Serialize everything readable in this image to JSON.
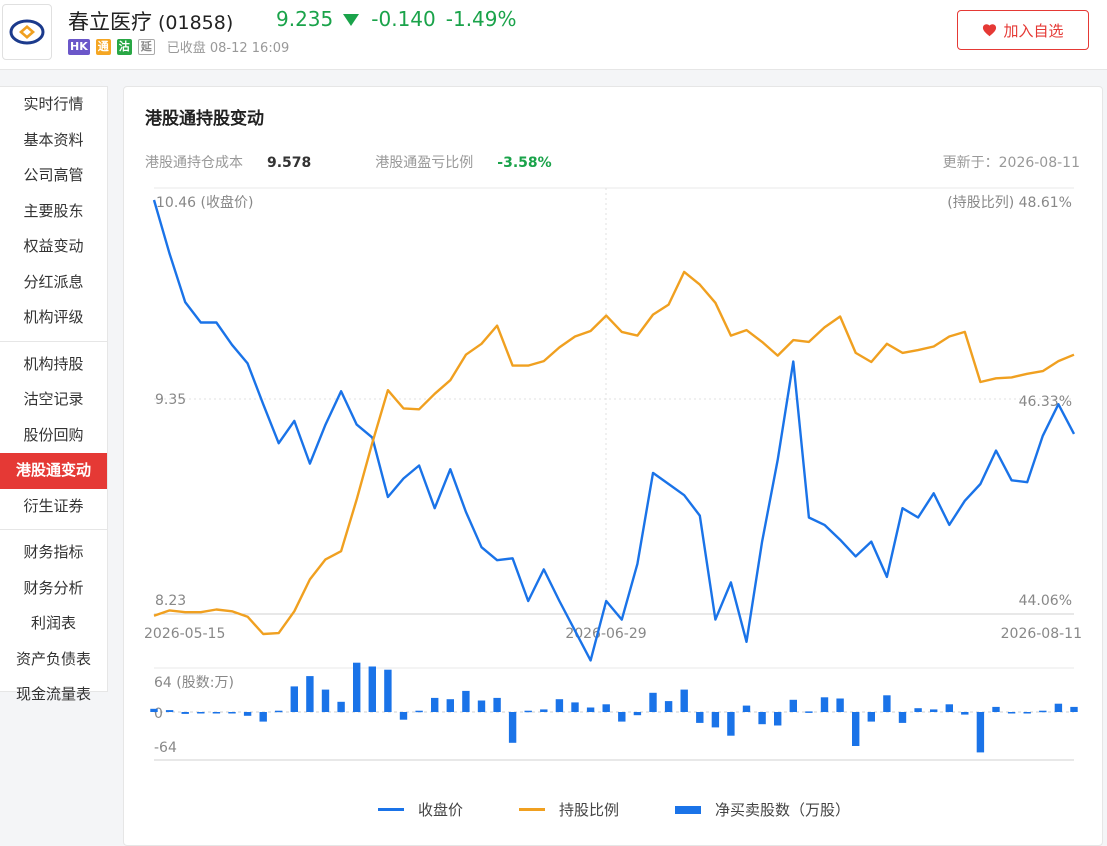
{
  "header": {
    "name": "春立医疗",
    "code": "(01858)",
    "price": "9.235",
    "change": "-0.140",
    "change_pct": "-1.49%",
    "tags": [
      "HK",
      "通",
      "沽",
      "延"
    ],
    "status": "已收盘 08-12 16:09",
    "watch_label": "加入自选"
  },
  "sidebar": {
    "groups": [
      [
        "实时行情",
        "基本资料",
        "公司高管",
        "主要股东",
        "权益变动",
        "分红派息",
        "机构评级"
      ],
      [
        "机构持股",
        "沽空记录",
        "股份回购",
        "港股通变动",
        "衍生证券"
      ],
      [
        "财务指标",
        "财务分析",
        "利润表",
        "资产负债表",
        "现金流量表"
      ]
    ],
    "active": "港股通变动"
  },
  "panel": {
    "title": "港股通持股变动",
    "cost_label": "港股通持仓成本",
    "cost_value": "9.578",
    "pl_label": "港股通盈亏比例",
    "pl_value": "-3.58%",
    "updated": "更新于：2026-08-11"
  },
  "chart_data": {
    "type": "line",
    "x_ticks": [
      "2026-05-15",
      "2026-06-29",
      "2026-08-11"
    ],
    "price_axis": {
      "label": "10.46 (收盘价)",
      "max": 10.46,
      "mid": 9.35,
      "min": 8.23,
      "mid_label": "9.35",
      "min_label": "8.23"
    },
    "ratio_axis": {
      "label": "(持股比列) 48.61%",
      "max": 48.61,
      "mid": 46.33,
      "min": 44.06,
      "mid_label": "46.33%",
      "min_label": "44.06%"
    },
    "volume_axis": {
      "label": "64 (股数:万)",
      "max": 64,
      "min": -64,
      "zero_label": "0",
      "min_label": "-64"
    },
    "series": [
      {
        "name": "收盘价",
        "color": "#1a73e8",
        "values": [
          10.46,
          10.17,
          9.91,
          9.8,
          9.8,
          9.68,
          9.58,
          9.36,
          9.15,
          9.27,
          9.04,
          9.25,
          9.43,
          9.25,
          9.18,
          8.86,
          8.96,
          9.03,
          8.8,
          9.01,
          8.78,
          8.59,
          8.52,
          8.53,
          8.3,
          8.47,
          8.3,
          8.14,
          7.98,
          8.3,
          8.2,
          8.5,
          8.99,
          8.93,
          8.87,
          8.76,
          8.2,
          8.4,
          8.08,
          8.62,
          9.06,
          9.59,
          8.75,
          8.71,
          8.63,
          8.54,
          8.62,
          8.43,
          8.8,
          8.75,
          8.88,
          8.71,
          8.84,
          8.93,
          9.11,
          8.95,
          8.94,
          9.19,
          9.36,
          9.2
        ]
      },
      {
        "name": "持股比例",
        "color": "#f0a020",
        "values": [
          44.04,
          44.1,
          44.08,
          44.08,
          44.11,
          44.09,
          44.03,
          43.84,
          43.85,
          44.09,
          44.44,
          44.66,
          44.75,
          45.32,
          45.94,
          46.52,
          46.32,
          46.31,
          46.48,
          46.63,
          46.91,
          47.03,
          47.23,
          46.79,
          46.79,
          46.84,
          46.99,
          47.11,
          47.17,
          47.34,
          47.16,
          47.12,
          47.35,
          47.46,
          47.82,
          47.68,
          47.48,
          47.12,
          47.18,
          47.05,
          46.9,
          47.07,
          47.05,
          47.21,
          47.33,
          46.93,
          46.83,
          47.03,
          46.93,
          46.96,
          47.0,
          47.11,
          47.16,
          46.61,
          46.65,
          46.66,
          46.7,
          46.73,
          46.84,
          46.91
        ]
      },
      {
        "name": "净买卖股数（万股）",
        "color": "#1a73e8",
        "values": [
          5,
          3,
          -3,
          0,
          -1,
          -2,
          -6,
          -15,
          2,
          40,
          56,
          35,
          16,
          77,
          71,
          66,
          -12,
          2,
          22,
          20,
          33,
          18,
          22,
          -48,
          2,
          4,
          20,
          15,
          7,
          12,
          -15,
          -5,
          30,
          17,
          35,
          -17,
          -24,
          -37,
          10,
          -19,
          -21,
          19,
          1,
          23,
          21,
          -53,
          -15,
          26,
          -17,
          6,
          4,
          12,
          -4,
          -63,
          8,
          0,
          0,
          2,
          13,
          8
        ]
      }
    ]
  }
}
